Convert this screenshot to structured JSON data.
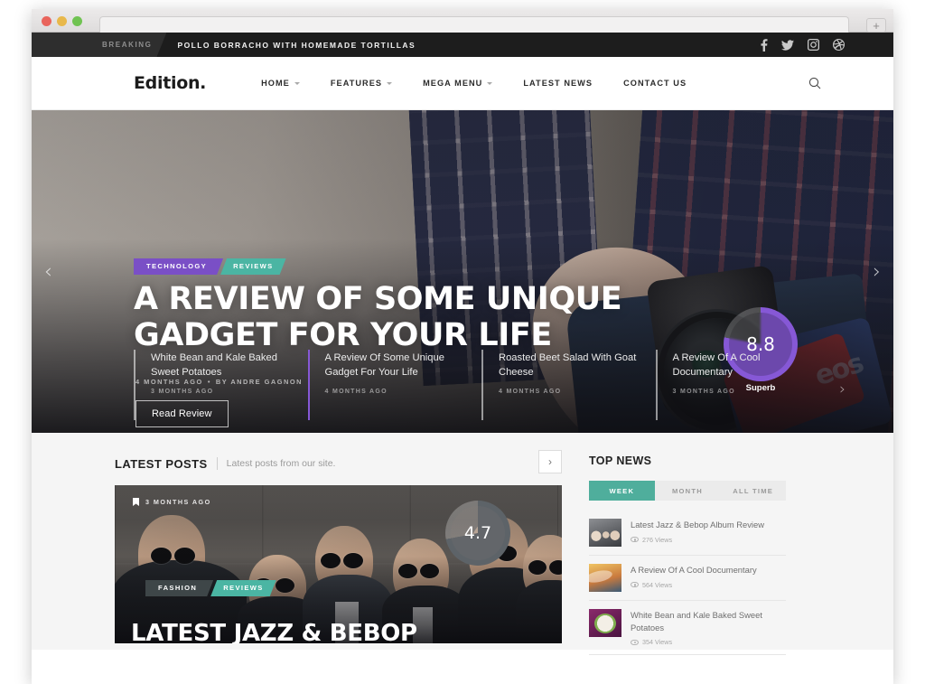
{
  "browser": {
    "newtab_label": "+"
  },
  "topbar": {
    "breaking_label": "BREAKING",
    "breaking_headline": "POLLO BORRACHO WITH HOMEMADE TORTILLAS",
    "social": [
      {
        "name": "facebook-icon"
      },
      {
        "name": "twitter-icon"
      },
      {
        "name": "instagram-icon"
      },
      {
        "name": "dribbble-icon"
      }
    ]
  },
  "header": {
    "logo": "Edition",
    "logo_dot": ".",
    "nav": [
      {
        "label": "HOME",
        "has_caret": true
      },
      {
        "label": "FEATURES",
        "has_caret": true
      },
      {
        "label": "MEGA MENU",
        "has_caret": true
      },
      {
        "label": "LATEST NEWS",
        "has_caret": false
      },
      {
        "label": "CONTACT US",
        "has_caret": false
      }
    ],
    "search_icon": "search-icon"
  },
  "hero": {
    "tags": [
      {
        "label": "TECHNOLOGY",
        "color": "#7a4fc6"
      },
      {
        "label": "REVIEWS",
        "color": "#4bb5a3"
      }
    ],
    "title": "A Review Of Some Unique Gadget For Your Life",
    "date": "4 MONTHS AGO",
    "separator": "•",
    "author": "BY ANDRE GAGNON",
    "button": "Read Review",
    "rating": "8.8",
    "rating_caption": "Superb",
    "rating_color": "#8658d6",
    "prev_arrow": "‹",
    "next_arrow": "›",
    "thumbs": [
      {
        "title": "White Bean and Kale Baked Sweet Potatoes",
        "date": "3 MONTHS AGO",
        "active": false
      },
      {
        "title": "A Review Of Some Unique Gadget For Your Life",
        "date": "4 MONTHS AGO",
        "active": true
      },
      {
        "title": "Roasted Beet Salad With Goat Cheese",
        "date": "4 MONTHS AGO",
        "active": false
      },
      {
        "title": "A Review Of A Cool Documentary",
        "date": "3 MONTHS AGO",
        "active": false
      }
    ],
    "thumbs_next": "›"
  },
  "latest_posts": {
    "title": "LATEST POSTS",
    "subtitle": "Latest posts from our site.",
    "next_arrow": "›",
    "card": {
      "date": "3 MONTHS AGO",
      "tags": [
        {
          "label": "FASHION",
          "color": "#3e4648"
        },
        {
          "label": "REVIEWS",
          "color": "#4bb5a3"
        }
      ],
      "title": "Latest Jazz & Bebop",
      "rating": "4.7",
      "rating_color": "#5d6368"
    }
  },
  "top_news": {
    "title": "TOP NEWS",
    "tabs": [
      {
        "label": "WEEK",
        "active": true
      },
      {
        "label": "MONTH",
        "active": false
      },
      {
        "label": "ALL TIME",
        "active": false
      }
    ],
    "active_color": "#4fae9c",
    "items": [
      {
        "headline": "Latest Jazz & Bebop Album Review",
        "views": "276 Views",
        "thumb": "a"
      },
      {
        "headline": "A Review Of A Cool Documentary",
        "views": "564 Views",
        "thumb": "b"
      },
      {
        "headline": "White Bean and Kale Baked Sweet Potatoes",
        "views": "354 Views",
        "thumb": "c"
      }
    ]
  }
}
